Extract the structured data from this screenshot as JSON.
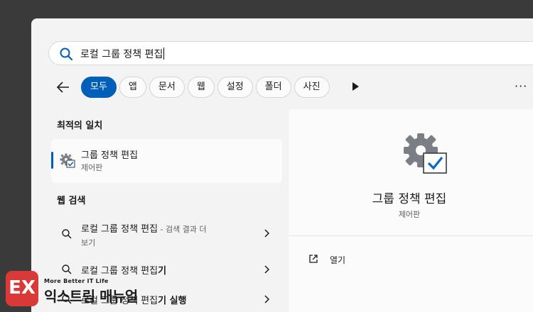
{
  "search": {
    "query": "로컬 그룹 정책 편집"
  },
  "filters": [
    {
      "label": "모두",
      "active": true
    },
    {
      "label": "앱",
      "active": false
    },
    {
      "label": "문서",
      "active": false
    },
    {
      "label": "웹",
      "active": false
    },
    {
      "label": "설정",
      "active": false
    },
    {
      "label": "폴더",
      "active": false
    },
    {
      "label": "사진",
      "active": false
    }
  ],
  "more_label": "···",
  "best_match": {
    "heading": "최적의 일치",
    "title": "그룹 정책 편집",
    "subtitle": "제어판",
    "icon": "gear-check-icon"
  },
  "web_search": {
    "heading": "웹 검색",
    "items": [
      {
        "text": "로컬 그룹 정책 편집",
        "extra": " - 검색 결과 더",
        "wrap": "보기"
      },
      {
        "text": "로컬 그룹 정책 편집",
        "bold": "기"
      },
      {
        "text": "로컬 그룹 정책 편집",
        "bold": "기 실행"
      }
    ]
  },
  "detail": {
    "title": "그룹 정책 편집",
    "subtitle": "제어판",
    "open_label": "열기"
  },
  "watermark": {
    "logo": "EX",
    "tagline": "More Better IT Life",
    "name": "익스트림 매뉴얼"
  },
  "colors": {
    "accent": "#005fb8",
    "panel": "#f3f3f3",
    "card": "#fbfbfb",
    "watermark": "#d93a38"
  }
}
